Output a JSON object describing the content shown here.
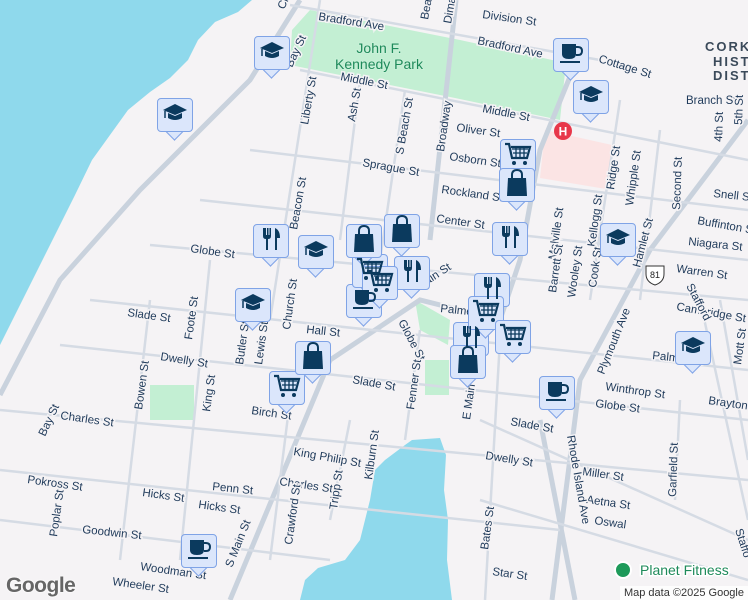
{
  "colors": {
    "water": "#8fd9ec",
    "park": "#c3efd3",
    "hospital_area": "#fbe4e4",
    "marker_bg": "#dbe6fb",
    "marker_border": "#7fa3e6",
    "icon": "#0b3a5e",
    "hospital": "#e8374a"
  },
  "park": {
    "line1": "John F.",
    "line2": "Kennedy Park"
  },
  "district": [
    "CORKY",
    "HISTO",
    "DISTR"
  ],
  "streets": {
    "bradford1": "Bradford Ave",
    "bradford2": "Bradford Ave",
    "division": "Division St",
    "middle1": "Middle St",
    "middle2": "Middle St",
    "oliver": "Oliver St",
    "osborn": "Osborn St",
    "sprague": "Sprague St",
    "rockland": "Rockland St",
    "center": "Center St",
    "cottage": "Cottage St",
    "branch": "Branch St",
    "liberty": "Liberty St",
    "ash": "Ash St",
    "sbeach": "S Beach St",
    "broadway": "Broadway",
    "beacon": "Beacon St",
    "globe1": "Globe St",
    "slade1": "Slade St",
    "hall": "Hall St",
    "dwelly1": "Dwelly St",
    "birch": "Birch St",
    "charles1": "Charles St",
    "bay1": "Bay St",
    "bay2": "Bay St",
    "bowen": "Bowen St",
    "foote": "Foote St",
    "king": "King St",
    "butler": "Butler St",
    "lewis": "Lewis St",
    "church": "Church St",
    "smain1": "S Main St",
    "smain2": "S Main St",
    "globe2": "Globe St",
    "fenner": "Fenner St",
    "emain": "E Main St",
    "slade2": "Slade St",
    "slade3": "Slade St",
    "globe3": "Globe St",
    "winthrop": "Winthrop St",
    "palmer": "Palmer St",
    "palme": "Palme",
    "cambridge": "Cambridge St",
    "warren": "Warren St",
    "niagara": "Niagara St",
    "buffinton": "Buffinton St",
    "snell": "Snell St",
    "brayton": "Brayton",
    "dwelly2": "Dwelly St",
    "kingphilip": "King Philip St",
    "kilburn": "Kilburn St",
    "charles2": "Charles St",
    "penn": "Penn St",
    "hicks1": "Hicks St",
    "hicks2": "Hicks St",
    "pokross": "Pokross St",
    "poplar": "Poplar St",
    "goodwin": "Goodwin St",
    "crawford": "Crawford St",
    "tripp": "Tripp St",
    "woodman": "Woodman St",
    "wheeler": "Wheeler St",
    "miller": "Miller St",
    "aetna": "Aetna St",
    "oswald": "Oswal",
    "garfield": "Garfield St",
    "bates": "Bates St",
    "star": "Star St",
    "rhodeisland": "Rhode Island Ave",
    "plymouth": "Plymouth Ave",
    "stafford1": "Stafford",
    "stafford2": "Staffo",
    "melville": "Melville St",
    "kellogg": "Kellogg St",
    "ridge": "Ridge St",
    "whipple": "Whipple St",
    "second": "Second St",
    "barrett": "Barrett St",
    "wooley": "Wooley St",
    "cook": "Cook St",
    "fourth": "4th St",
    "fifth": "5th St",
    "mott": "Mott St",
    "hamlet": "Hamlet St",
    "beach": "Beac",
    "dimas": "Dima",
    "cla": "Cla"
  },
  "route_shield": "81",
  "hospital_label": "H",
  "poi": {
    "planet_fitness": "Planet Fitness"
  },
  "markers": [
    {
      "type": "school"
    },
    {
      "type": "school"
    },
    {
      "type": "school"
    },
    {
      "type": "school"
    },
    {
      "type": "school"
    },
    {
      "type": "school"
    },
    {
      "type": "school"
    },
    {
      "type": "coffee"
    },
    {
      "type": "coffee"
    },
    {
      "type": "coffee"
    },
    {
      "type": "coffee"
    },
    {
      "type": "restaurant"
    },
    {
      "type": "restaurant"
    },
    {
      "type": "restaurant"
    },
    {
      "type": "restaurant"
    },
    {
      "type": "restaurant"
    },
    {
      "type": "grocery"
    },
    {
      "type": "grocery"
    },
    {
      "type": "grocery"
    },
    {
      "type": "grocery"
    },
    {
      "type": "grocery"
    },
    {
      "type": "grocery"
    },
    {
      "type": "shopping"
    },
    {
      "type": "shopping"
    },
    {
      "type": "shopping"
    },
    {
      "type": "shopping"
    },
    {
      "type": "shopping"
    }
  ],
  "attribution": "Map data ©2025 Google",
  "logo": "Google"
}
